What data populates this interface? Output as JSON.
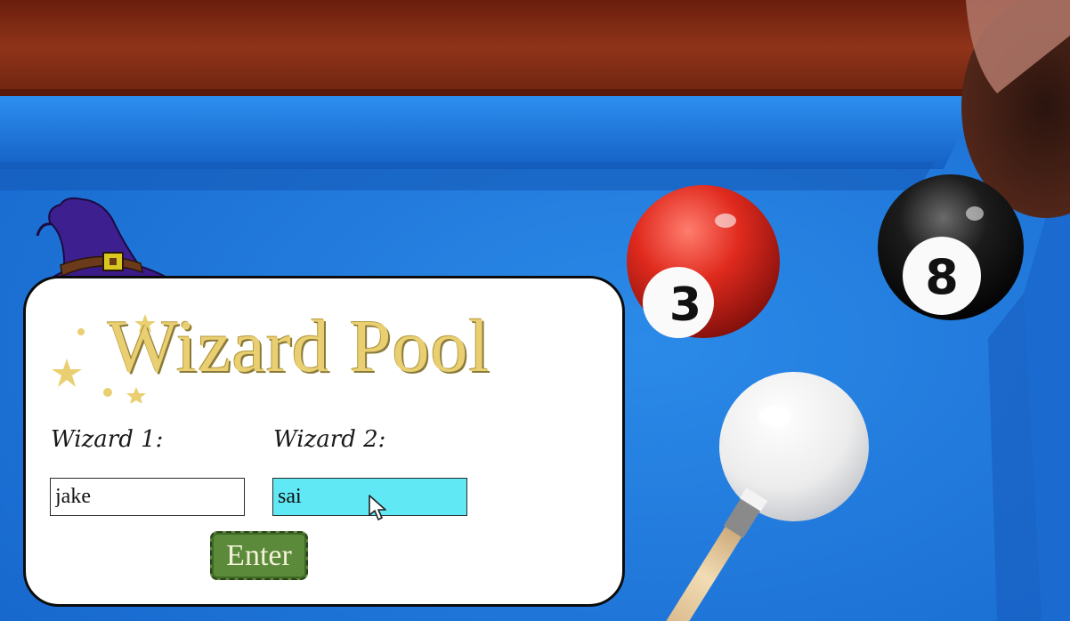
{
  "app": {
    "title": "Wizard Pool"
  },
  "form": {
    "wizard1_label": "Wizard 1:",
    "wizard2_label": "Wizard 2:",
    "wizard1_value": "jake",
    "wizard2_value": "sai",
    "enter_label": "Enter"
  },
  "balls": {
    "red_ball_number": "3",
    "black_ball_number": "8"
  },
  "colors": {
    "table_felt": "#1f78d8",
    "rail_wood": "#8a2f18",
    "title_gold": "#e9cf71",
    "active_field": "#60e8f4",
    "enter_button": "#5a8a3a"
  },
  "icons": [
    "wizard-hat-icon",
    "star-icon",
    "mouse-pointer-icon"
  ]
}
